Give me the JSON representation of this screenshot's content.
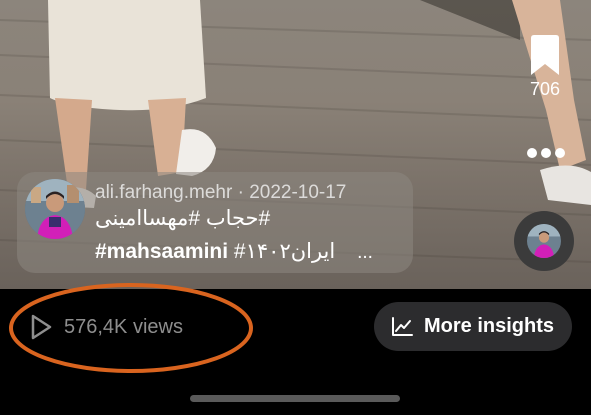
{
  "post": {
    "username": "ali.farhang.mehr",
    "separator": "·",
    "date": "2022-10-17",
    "caption_line1": "#حجاب #مهساامینی",
    "caption_line2_tag": "#mahsaamini",
    "caption_line2_fa": "#۱۴۰۲ایران",
    "caption_more": "..."
  },
  "actions": {
    "save_icon": "bookmark-icon",
    "save_count": "706",
    "more_icon": "more-dots-icon"
  },
  "stats": {
    "play_icon": "play-icon",
    "views_label": "576,4K views"
  },
  "insights": {
    "icon": "chart-line-icon",
    "label": "More insights"
  },
  "colors": {
    "annotation_ellipse": "#d9641f",
    "background": "#000000",
    "button_bg": "#2c2c2e",
    "muted_text": "#8e8e8e"
  }
}
